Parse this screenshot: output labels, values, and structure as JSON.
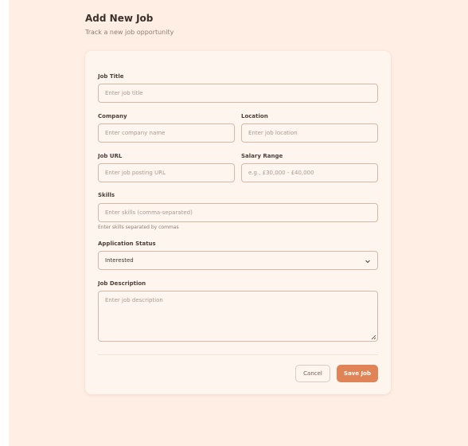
{
  "header": {
    "title": "Add New Job",
    "subtitle": "Track a new job opportunity"
  },
  "form": {
    "job_title": {
      "label": "Job Title",
      "placeholder": "Enter job title"
    },
    "company": {
      "label": "Company",
      "placeholder": "Enter company name"
    },
    "location": {
      "label": "Location",
      "placeholder": "Enter job location"
    },
    "job_url": {
      "label": "Job URL",
      "placeholder": "Enter job posting URL"
    },
    "salary_range": {
      "label": "Salary Range",
      "placeholder": "e.g., £30,000 - £40,000"
    },
    "skills": {
      "label": "Skills",
      "placeholder": "Enter skills (comma-separated)",
      "hint": "Enter skills separated by commas"
    },
    "status": {
      "label": "Application Status",
      "value": "Interested"
    },
    "description": {
      "label": "Job Description",
      "placeholder": "Enter job description"
    }
  },
  "actions": {
    "cancel_label": "Cancel",
    "save_label": "Save Job"
  },
  "colors": {
    "page_background": "#ffeee3",
    "card_background": "#fff5ef",
    "input_border": "#d9b8a6",
    "primary_button": "#e08458"
  },
  "icons": {
    "status_select": "chevron-down-icon",
    "textarea_resize": "resize-handle-icon"
  }
}
